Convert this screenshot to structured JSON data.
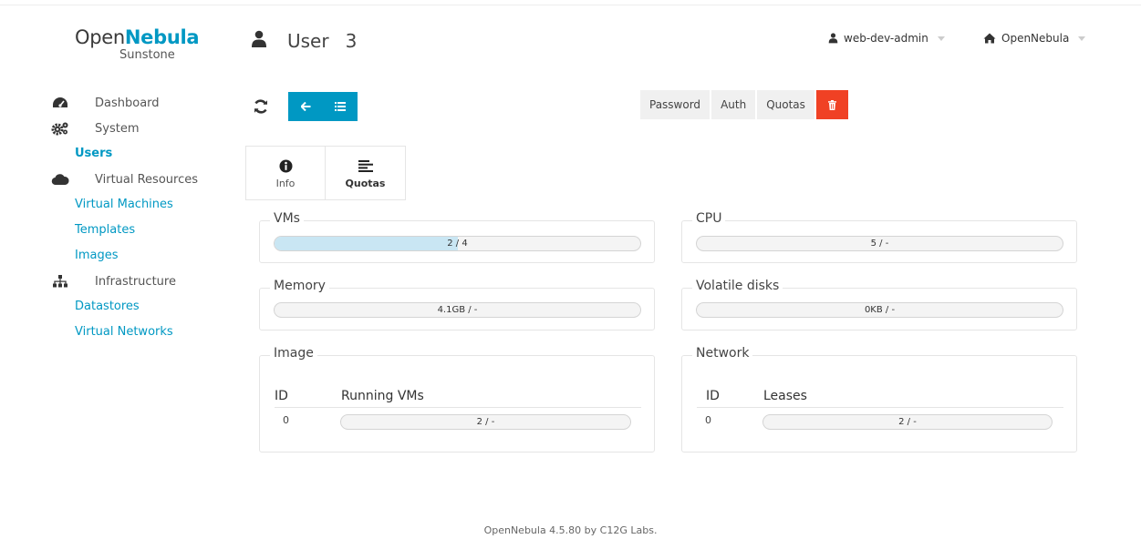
{
  "logo": {
    "part1": "Open",
    "part2": "Nebula",
    "sub": "Sunstone"
  },
  "sidebar": {
    "dashboard": "Dashboard",
    "system": "System",
    "users": "Users",
    "virtual_resources": "Virtual Resources",
    "virtual_machines": "Virtual Machines",
    "templates": "Templates",
    "images": "Images",
    "infrastructure": "Infrastructure",
    "datastores": "Datastores",
    "virtual_networks": "Virtual Networks"
  },
  "header": {
    "title": "User",
    "id": "3",
    "user": "web-dev-admin",
    "zone": "OpenNebula"
  },
  "toolbar": {
    "password": "Password",
    "auth": "Auth",
    "quotas": "Quotas"
  },
  "tabs": {
    "info": "Info",
    "quotas": "Quotas"
  },
  "quotas": {
    "vms": {
      "label": "VMs",
      "text": "2 / 4",
      "fraction": 0.5
    },
    "cpu": {
      "label": "CPU",
      "text": "5 / -"
    },
    "memory": {
      "label": "Memory",
      "text": "4.1GB / -"
    },
    "volatile": {
      "label": "Volatile disks",
      "text": "0KB / -"
    },
    "image": {
      "label": "Image",
      "col_id": "ID",
      "col_value": "Running VMs",
      "rows": [
        {
          "id": "0",
          "text": "2 / -"
        }
      ]
    },
    "network": {
      "label": "Network",
      "col_id": "ID",
      "col_value": "Leases",
      "rows": [
        {
          "id": "0",
          "text": "2 / -"
        }
      ]
    }
  },
  "footer": "OpenNebula 4.5.80 by C12G Labs.",
  "colors": {
    "accent": "#0098c3",
    "danger": "#f04124",
    "bar_fill": "#c9e6f3"
  }
}
